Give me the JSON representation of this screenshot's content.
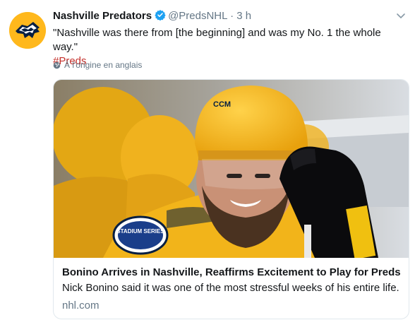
{
  "tweet": {
    "author_name": "Nashville Predators",
    "handle": "@PredsNHL",
    "separator": "·",
    "time": "3 h",
    "text": "\"Nashville was there from [the beginning] and was my No. 1 the whole way.\"",
    "hashtag": "#Preds",
    "translate_label": "À l'origine en anglais"
  },
  "card": {
    "title": "Bonino Arrives in Nashville, Reaffirms Excitement to Play for Preds",
    "description": "Nick Bonino said it was one of the most stressful weeks of his entire life.",
    "domain": "nhl.com",
    "helmet_brand": "CCM",
    "patch_text": "STADIUM SERIES"
  },
  "colors": {
    "preds_gold": "#ffb81c",
    "preds_navy": "#041e42",
    "hashtag": "#c4302b",
    "verified": "#1da1f2"
  },
  "icons": {
    "verified": "verified-badge-icon",
    "caret": "chevron-down-icon",
    "globe": "globe-icon"
  }
}
